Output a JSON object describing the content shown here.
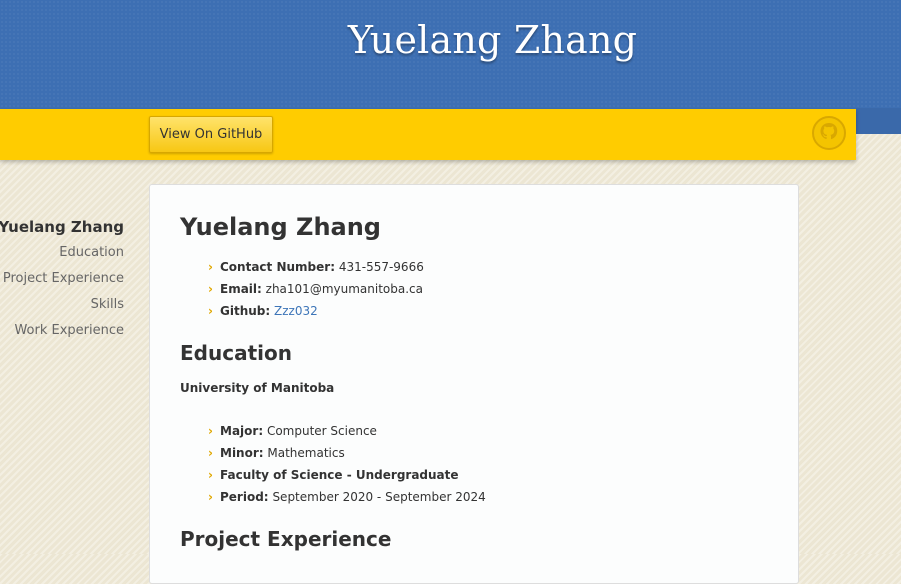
{
  "header": {
    "title": "Yuelang Zhang"
  },
  "ribbon": {
    "button_label": "View On GitHub",
    "icon": "github-octocat-icon",
    "color": "#ffcc00"
  },
  "colors": {
    "header_bg": "#3d6fb3",
    "accent": "#e0a800",
    "link": "#3d75b8"
  },
  "sidebar": {
    "items": [
      {
        "label": "Yuelang Zhang",
        "active": true
      },
      {
        "label": "Education"
      },
      {
        "label": "Project Experience"
      },
      {
        "label": "Skills"
      },
      {
        "label": "Work Experience"
      }
    ]
  },
  "main": {
    "name": "Yuelang Zhang",
    "contact": [
      {
        "label": "Contact Number:",
        "value": "431-557-9666"
      },
      {
        "label": "Email:",
        "value": "zha101@myumanitoba.ca"
      },
      {
        "label": "Github:",
        "value": "Zzz032"
      }
    ],
    "education": {
      "heading": "Education",
      "school": "University of Manitoba",
      "items": [
        {
          "label": "Major:",
          "value": "Computer Science"
        },
        {
          "label": "Minor:",
          "value": "Mathematics"
        },
        {
          "label": "Faculty of Science - Undergraduate",
          "value": ""
        },
        {
          "label": "Period:",
          "value": "September 2020 - September 2024"
        }
      ]
    },
    "project_heading": "Project Experience"
  }
}
